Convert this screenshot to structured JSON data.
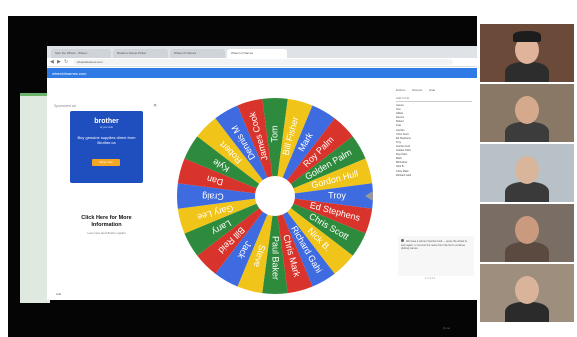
{
  "browser": {
    "tabs": [
      "Spin the Wheel - Wheel...",
      "Random Name Picker",
      "Wheel of Names",
      "Wheel of Names"
    ],
    "url": "wheelofnames.com",
    "site_title": "wheelofnames.com"
  },
  "ad": {
    "label": "Sponsored ad",
    "close": "✕",
    "brand": "brother",
    "tagline": "at your side",
    "text": "Buy genuine supplies direct from Brother.ca",
    "button": "Shop now",
    "click_title": "Click Here for More Information",
    "click_sub": "Learn more about Brother supplies",
    "bottom": "Ads"
  },
  "wheel": {
    "names": [
      "Tom",
      "Bill Fisher",
      "Mark",
      "Roy Palm",
      "Golden Palm",
      "Gordon Hull",
      "Troy",
      "Ed Stephens",
      "Chris Scott",
      "Nick B.",
      "Richard Gahi",
      "Chris Mark",
      "Paul Baker",
      "Steve",
      "Jack",
      "Bill Reid",
      "Larry",
      "Gary Lee",
      "Craig",
      "Dan",
      "Kyle",
      "Robert",
      "Dennis M",
      "James Cook"
    ],
    "colors": [
      "#2e8b3d",
      "#f0c419",
      "#3f6be0",
      "#d9342b"
    ]
  },
  "right_panel": {
    "tabs": [
      "Entries",
      "Results",
      "Hide"
    ],
    "list_header": "Add to list",
    "entries": [
      "James",
      "Tom",
      "Gillian",
      "Dennis",
      "Robert",
      "Kyle",
      "Gordon",
      "Chris Scott",
      "Ed Stephens",
      "Troy",
      "Gordon Hull",
      "Golden Palm",
      "Roy Palm",
      "Mark",
      "Bill Fisher",
      "Nick B.",
      "Chris Mark",
      "Richard Gahi"
    ],
    "result_text": "We have a winner! Gordon Hull — press the wheel to spin again, or remove the name from the list to continue picking names.",
    "pager": "1 2 3 4 5",
    "done": "Done"
  },
  "video": {
    "tiles": [
      {
        "bg": "#6b4a3a",
        "head": "#e0b49a",
        "body": "#2d2d2d",
        "hat": "#1d1d1d"
      },
      {
        "bg": "#8a7866",
        "head": "#d4a98c",
        "body": "#3c3c3c"
      },
      {
        "bg": "#b7c1c7",
        "head": "#d9b59c",
        "body": "#3a3a3a"
      },
      {
        "bg": "#7a6e64",
        "head": "#c99a7e",
        "body": "#5a4a40"
      },
      {
        "bg": "#9d8e7e",
        "head": "#d9b49a",
        "body": "#2b2b2b"
      }
    ]
  }
}
